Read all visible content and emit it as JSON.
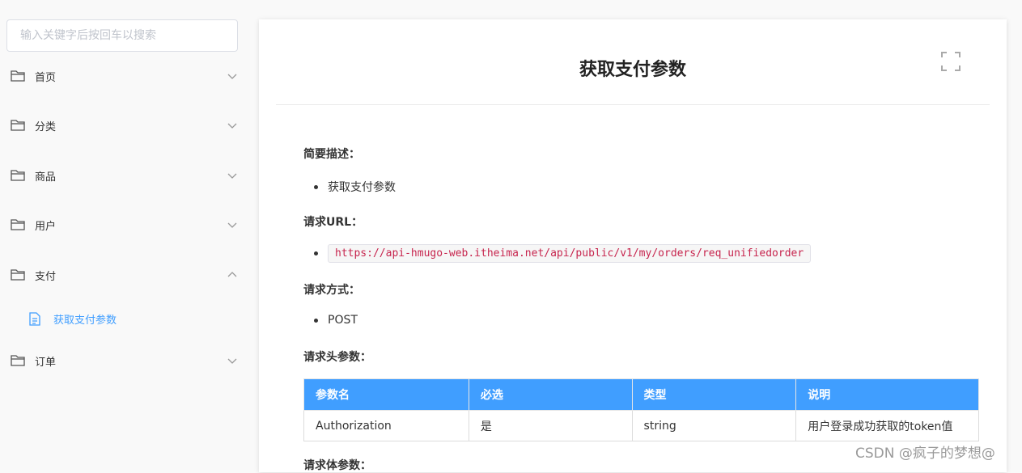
{
  "search": {
    "placeholder": "输入关键字后按回车以搜索"
  },
  "sidebar": {
    "items": [
      {
        "label": "首页",
        "icon": "folder-icon",
        "expanded": false
      },
      {
        "label": "分类",
        "icon": "folder-icon",
        "expanded": false
      },
      {
        "label": "商品",
        "icon": "folder-icon",
        "expanded": false
      },
      {
        "label": "用户",
        "icon": "folder-icon",
        "expanded": false
      },
      {
        "label": "支付",
        "icon": "folder-icon",
        "expanded": true
      },
      {
        "label": "订单",
        "icon": "folder-icon",
        "expanded": false
      }
    ],
    "sub_item": {
      "label": "获取支付参数",
      "icon": "document-icon"
    }
  },
  "doc": {
    "title": "获取支付参数",
    "summary_heading": "简要描述：",
    "summary_item": "获取支付参数",
    "url_heading": "请求URL：",
    "url": "https://api-hmugo-web.itheima.net/api/public/v1/my/orders/req_unifiedorder",
    "method_heading": "请求方式：",
    "method": "POST",
    "headers_heading": "请求头参数：",
    "table": {
      "headers": [
        "参数名",
        "必选",
        "类型",
        "说明"
      ],
      "rows": [
        [
          "Authorization",
          "是",
          "string",
          "用户登录成功获取的token值"
        ]
      ]
    },
    "body_heading": "请求体参数："
  },
  "watermark": "CSDN @疯子的梦想@",
  "colors": {
    "accent": "#409eff",
    "code": "#c7254e"
  }
}
